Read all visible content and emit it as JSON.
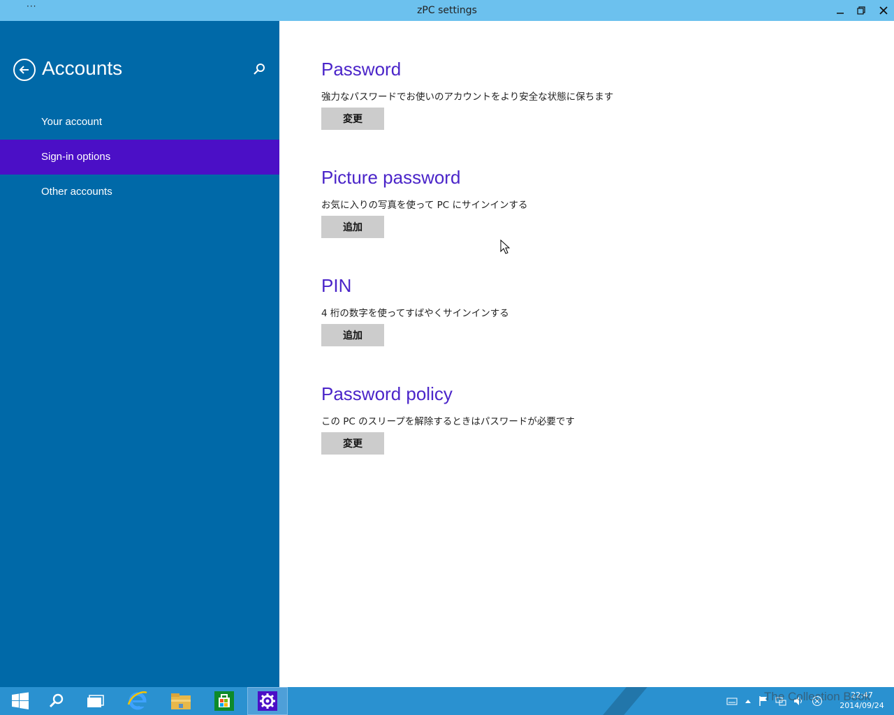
{
  "window": {
    "title": "zPC settings",
    "menu_dots": "···",
    "minimize_label": "–",
    "maximize_label": "▫",
    "close_label": "✕"
  },
  "sidebar": {
    "heading": "Accounts",
    "items": [
      {
        "label": "Your account",
        "active": false
      },
      {
        "label": "Sign-in options",
        "active": true
      },
      {
        "label": "Other accounts",
        "active": false
      }
    ]
  },
  "sections": [
    {
      "title": "Password",
      "description": "強力なパスワードでお使いのアカウントをより安全な状態に保ちます",
      "button": "変更"
    },
    {
      "title": "Picture password",
      "description": "お気に入りの写真を使って PC にサインインする",
      "button": "追加"
    },
    {
      "title": "PIN",
      "description": "4 桁の数字を使ってすばやくサインインする",
      "button": "追加"
    },
    {
      "title": "Password policy",
      "description": "この PC のスリープを解除するときはパスワードが必要です",
      "button": "変更"
    }
  ],
  "taskbar": {
    "apps": [
      "start-icon",
      "search-icon",
      "task-view-icon",
      "internet-explorer-icon",
      "file-explorer-icon",
      "store-icon",
      "settings-icon"
    ],
    "active_app": "settings-icon"
  },
  "clock": {
    "time": "22:47",
    "date": "2014/09/24"
  },
  "watermark": "The Collection Book",
  "colors": {
    "titlebar": "#6cc1ee",
    "sidebar": "#0069a8",
    "active_nav": "#4b0fc6",
    "section_title": "#4b25c9",
    "button": "#cccccc",
    "taskbar": "#2a91d0"
  }
}
